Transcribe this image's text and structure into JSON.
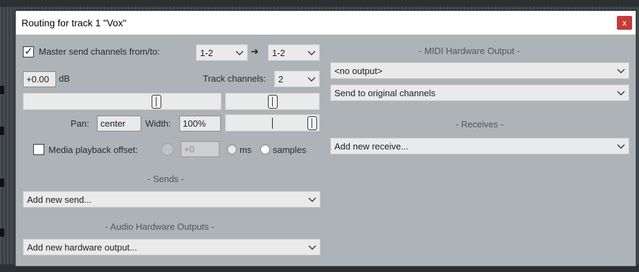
{
  "window": {
    "title": "Routing for track 1 \"Vox\"",
    "close_glyph": "x"
  },
  "master_send": {
    "checked": true,
    "label": "Master send channels from/to:",
    "from_value": "1-2",
    "arrow_glyph": "➜",
    "to_value": "1-2"
  },
  "volume": {
    "value": "+0.00",
    "unit": "dB"
  },
  "track_channels": {
    "label": "Track channels:",
    "value": "2"
  },
  "pan": {
    "label": "Pan:",
    "value": "center"
  },
  "width": {
    "label": "Width:",
    "value": "100%"
  },
  "media_offset": {
    "checked": false,
    "label": "Media playback offset:",
    "value": "+0",
    "unit_options": [
      "ms",
      "samples"
    ]
  },
  "sends": {
    "heading": "- Sends -",
    "dropdown": "Add new send..."
  },
  "audio_hw": {
    "heading": "- Audio Hardware Outputs -",
    "dropdown": "Add new hardware output..."
  },
  "midi_hw": {
    "heading": "- MIDI Hardware Output -",
    "output": "<no output>",
    "channels": "Send to original channels"
  },
  "receives": {
    "heading": "- Receives -",
    "dropdown": "Add new receive..."
  },
  "colors": {
    "title_close": "#c63a3a",
    "dialog_bg": "#adb3b7",
    "field_bg": "#eaeaea"
  }
}
